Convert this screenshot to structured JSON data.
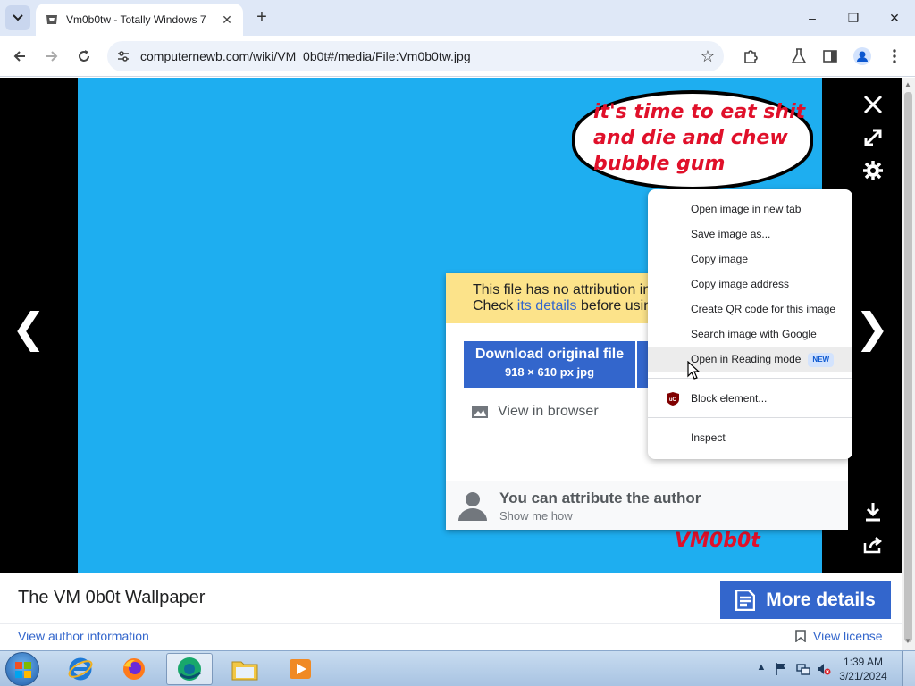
{
  "browser": {
    "tab": {
      "title": "Vm0b0tw - Totally Windows 7",
      "close": "✕"
    },
    "new_tab": "+",
    "window_controls": {
      "minimize": "–",
      "maximize": "❐",
      "close": "✕"
    },
    "url": "computernewb.com/wiki/VM_0b0t#/media/File:Vm0b0tw.jpg"
  },
  "viewer": {
    "image": {
      "speech_text": "it's time to eat shit and die and chew bubble gum",
      "watermark": "VM0b0t"
    },
    "prev_arrow": "❮",
    "next_arrow": "❯"
  },
  "download_panel": {
    "notice_line1": "This file has no attribution in",
    "notice_line2_prefix": "Check ",
    "notice_link": "its details",
    "notice_line2_suffix": " before usin",
    "download_label": "Download original file",
    "download_meta": "918 × 610 px jpg",
    "view_in_browser": "View in browser",
    "attribute_title": "You can attribute the author",
    "attribute_sub": "Show me how"
  },
  "context_menu": {
    "items": [
      {
        "label": "Open image in new tab"
      },
      {
        "label": "Save image as..."
      },
      {
        "label": "Copy image"
      },
      {
        "label": "Copy image address"
      },
      {
        "label": "Create QR code for this image"
      },
      {
        "label": "Search image with Google"
      },
      {
        "label": "Open in Reading mode",
        "badge": "NEW"
      },
      {
        "label": "Block element..."
      },
      {
        "label": "Inspect"
      }
    ]
  },
  "footer": {
    "file_title": "The VM 0b0t Wallpaper",
    "more_details": "More details",
    "author_link": "View author information",
    "license_link": "View license"
  },
  "taskbar": {
    "clock_time": "1:39 AM",
    "clock_date": "3/21/2024",
    "tray_chevron": "▲"
  },
  "colors": {
    "accent": "#3366cc",
    "image_background": "#1eaef0",
    "image_text": "#e0102a",
    "notice_yellow": "#fce38a"
  }
}
